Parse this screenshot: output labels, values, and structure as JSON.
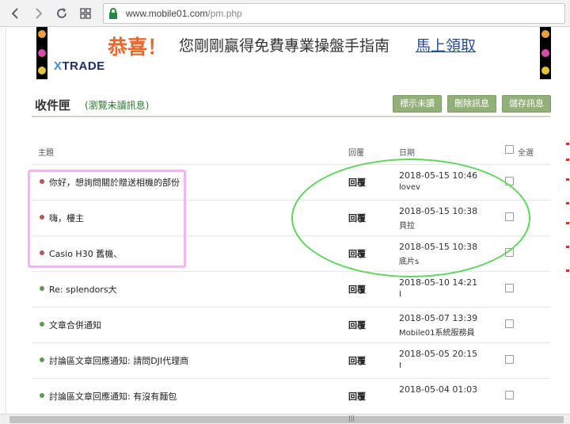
{
  "browser": {
    "url_host": "www.mobile01.com",
    "url_path": "/pm.php"
  },
  "banner": {
    "congrats": "恭喜！",
    "message": "您剛剛贏得免費專業操盤手指南",
    "link": "馬上領取",
    "logo_x": "X",
    "logo_rest": "TRADE"
  },
  "inbox": {
    "title": "收件匣",
    "view_unread": "(瀏覽未讀訊息)",
    "buttons": [
      "標示未讀",
      "刪除訊息",
      "儲存訊息"
    ],
    "headers": {
      "subject": "主題",
      "reply": "回覆",
      "date": "日期",
      "select_all": "全選"
    },
    "rows": [
      {
        "subject": "你好，想詢問關於贈送相機的部份",
        "reply": "回覆",
        "date": "2018-05-15 10:46",
        "sender": "lovev",
        "unread": true
      },
      {
        "subject": "嗨，樓主",
        "reply": "回覆",
        "date": "2018-05-15 10:38",
        "sender": "貝拉",
        "unread": true
      },
      {
        "subject": "Casio H30 舊機、",
        "reply": "回覆",
        "date": "2018-05-15 10:38",
        "sender": "底片s",
        "unread": true
      },
      {
        "subject": "Re: splendors大",
        "reply": "回覆",
        "date": "2018-05-10 14:21",
        "sender": "I",
        "unread": false
      },
      {
        "subject": "文章合併通知",
        "reply": "回覆",
        "date": "2018-05-07 13:39",
        "sender": "Mobile01系統服務員",
        "unread": false
      },
      {
        "subject": "討論區文章回應通知: 請問DJI代理商",
        "reply": "回覆",
        "date": "2018-05-05 20:15",
        "sender": "I",
        "unread": false
      },
      {
        "subject": "討論區文章回應通知: 有沒有麵包",
        "reply": "回覆",
        "date": "2018-05-04 01:03",
        "sender": "",
        "unread": false
      }
    ]
  },
  "colors": {
    "unread_dot": "#b0575a",
    "read_dot": "#5b9a52",
    "annotation_pink": "#f2b6ef",
    "annotation_green": "#5fd45f"
  },
  "icons": [
    "back-icon",
    "forward-icon",
    "reload-icon",
    "apps-icon",
    "lock-icon"
  ]
}
